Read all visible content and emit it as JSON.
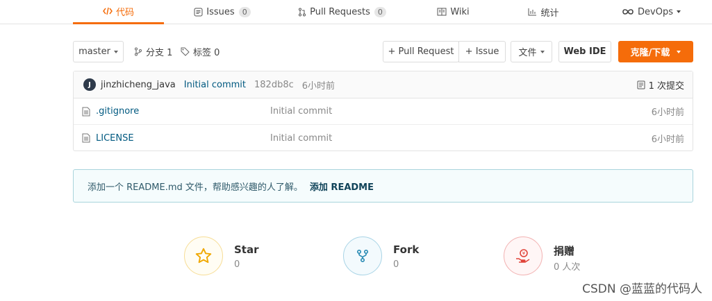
{
  "tabs": [
    {
      "label": "代码",
      "icon": "code-icon",
      "active": true
    },
    {
      "label": "Issues",
      "icon": "issue-icon",
      "count": "0"
    },
    {
      "label": "Pull Requests",
      "icon": "pull-request-icon",
      "count": "0"
    },
    {
      "label": "Wiki",
      "icon": "wiki-icon"
    },
    {
      "label": "统计",
      "icon": "stats-icon"
    },
    {
      "label": "DevOps",
      "icon": "devops-icon"
    }
  ],
  "toolbar": {
    "branch_select": "master",
    "branches_label": "分支 1",
    "tags_label": "标签 0",
    "pull_request_button": "+ Pull Request",
    "issue_button": "+ Issue",
    "file_button": "文件",
    "web_ide_button": "Web IDE",
    "clone_button": "克隆/下载"
  },
  "commit": {
    "avatar_letter": "J",
    "author": "jinzhicheng_java",
    "message": "Initial commit",
    "hash": "182db8c",
    "time": "6小时前",
    "count_label": "1 次提交"
  },
  "files": [
    {
      "name": ".gitignore",
      "message": "Initial commit",
      "time": "6小时前"
    },
    {
      "name": "LICENSE",
      "message": "Initial commit",
      "time": "6小时前"
    }
  ],
  "readme_notice": {
    "text": "添加一个 README.md 文件，帮助感兴趣的人了解。",
    "link": "添加 README"
  },
  "stats": {
    "star": {
      "label": "Star",
      "value": "0"
    },
    "fork": {
      "label": "Fork",
      "value": "0"
    },
    "donate": {
      "label": "捐赠",
      "value": "0 人次"
    }
  },
  "watermark": "CSDN @蓝蓝的代码人",
  "colors": {
    "accent": "#f56c0a",
    "link": "#005980",
    "notice_border": "#a9d4dc"
  }
}
